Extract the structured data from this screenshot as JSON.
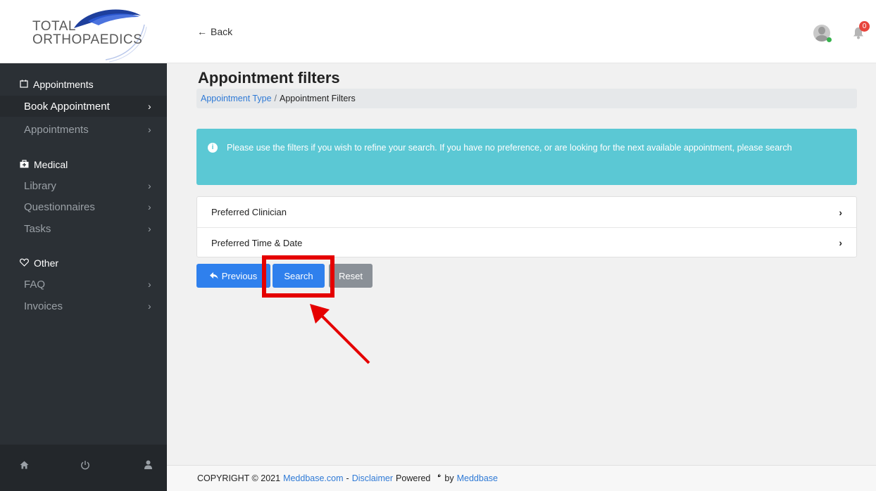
{
  "brand": {
    "line1": "TOTAL",
    "line2": "ORTHOPAEDICS"
  },
  "header": {
    "back_label": "Back",
    "notification_count": "0"
  },
  "sidebar": {
    "sections": [
      {
        "heading": "Appointments",
        "icon": "calendar-icon",
        "items": [
          {
            "label": "Book Appointment",
            "active": true
          },
          {
            "label": "Appointments",
            "active": false
          }
        ]
      },
      {
        "heading": "Medical",
        "icon": "medkit-icon",
        "items": [
          {
            "label": "Library",
            "active": false
          },
          {
            "label": "Questionnaires",
            "active": false
          },
          {
            "label": "Tasks",
            "active": false
          }
        ]
      },
      {
        "heading": "Other",
        "icon": "heart-icon",
        "items": [
          {
            "label": "FAQ",
            "active": false
          },
          {
            "label": "Invoices",
            "active": false
          }
        ]
      }
    ],
    "chevron": "›",
    "footer_icons": [
      "home-icon",
      "power-icon",
      "user-icon"
    ]
  },
  "main": {
    "title": "Appointment filters",
    "breadcrumb": {
      "link": "Appointment Type",
      "separator": "/",
      "current": "Appointment Filters"
    },
    "alert": {
      "icon": "info-icon",
      "text": "Please use the filters if you wish to refine your search. If you have no preference, or are looking for the next available appointment, please search"
    },
    "filters": [
      {
        "label": "Preferred Clinician"
      },
      {
        "label": "Preferred Time & Date"
      }
    ],
    "buttons": {
      "previous": "Previous",
      "search": "Search",
      "reset": "Reset"
    }
  },
  "footer": {
    "copyright": "COPYRIGHT © 2021",
    "site_link": "Meddbase.com",
    "dash": "-",
    "disclaimer": "Disclaimer",
    "powered": "Powered",
    "by": "by",
    "brand_link": "Meddbase"
  },
  "colors": {
    "sidebar_bg": "#2b3035",
    "primary": "#2f80ed",
    "info": "#5bc8d4",
    "secondary": "#8a9097",
    "annotation": "#e50000"
  }
}
